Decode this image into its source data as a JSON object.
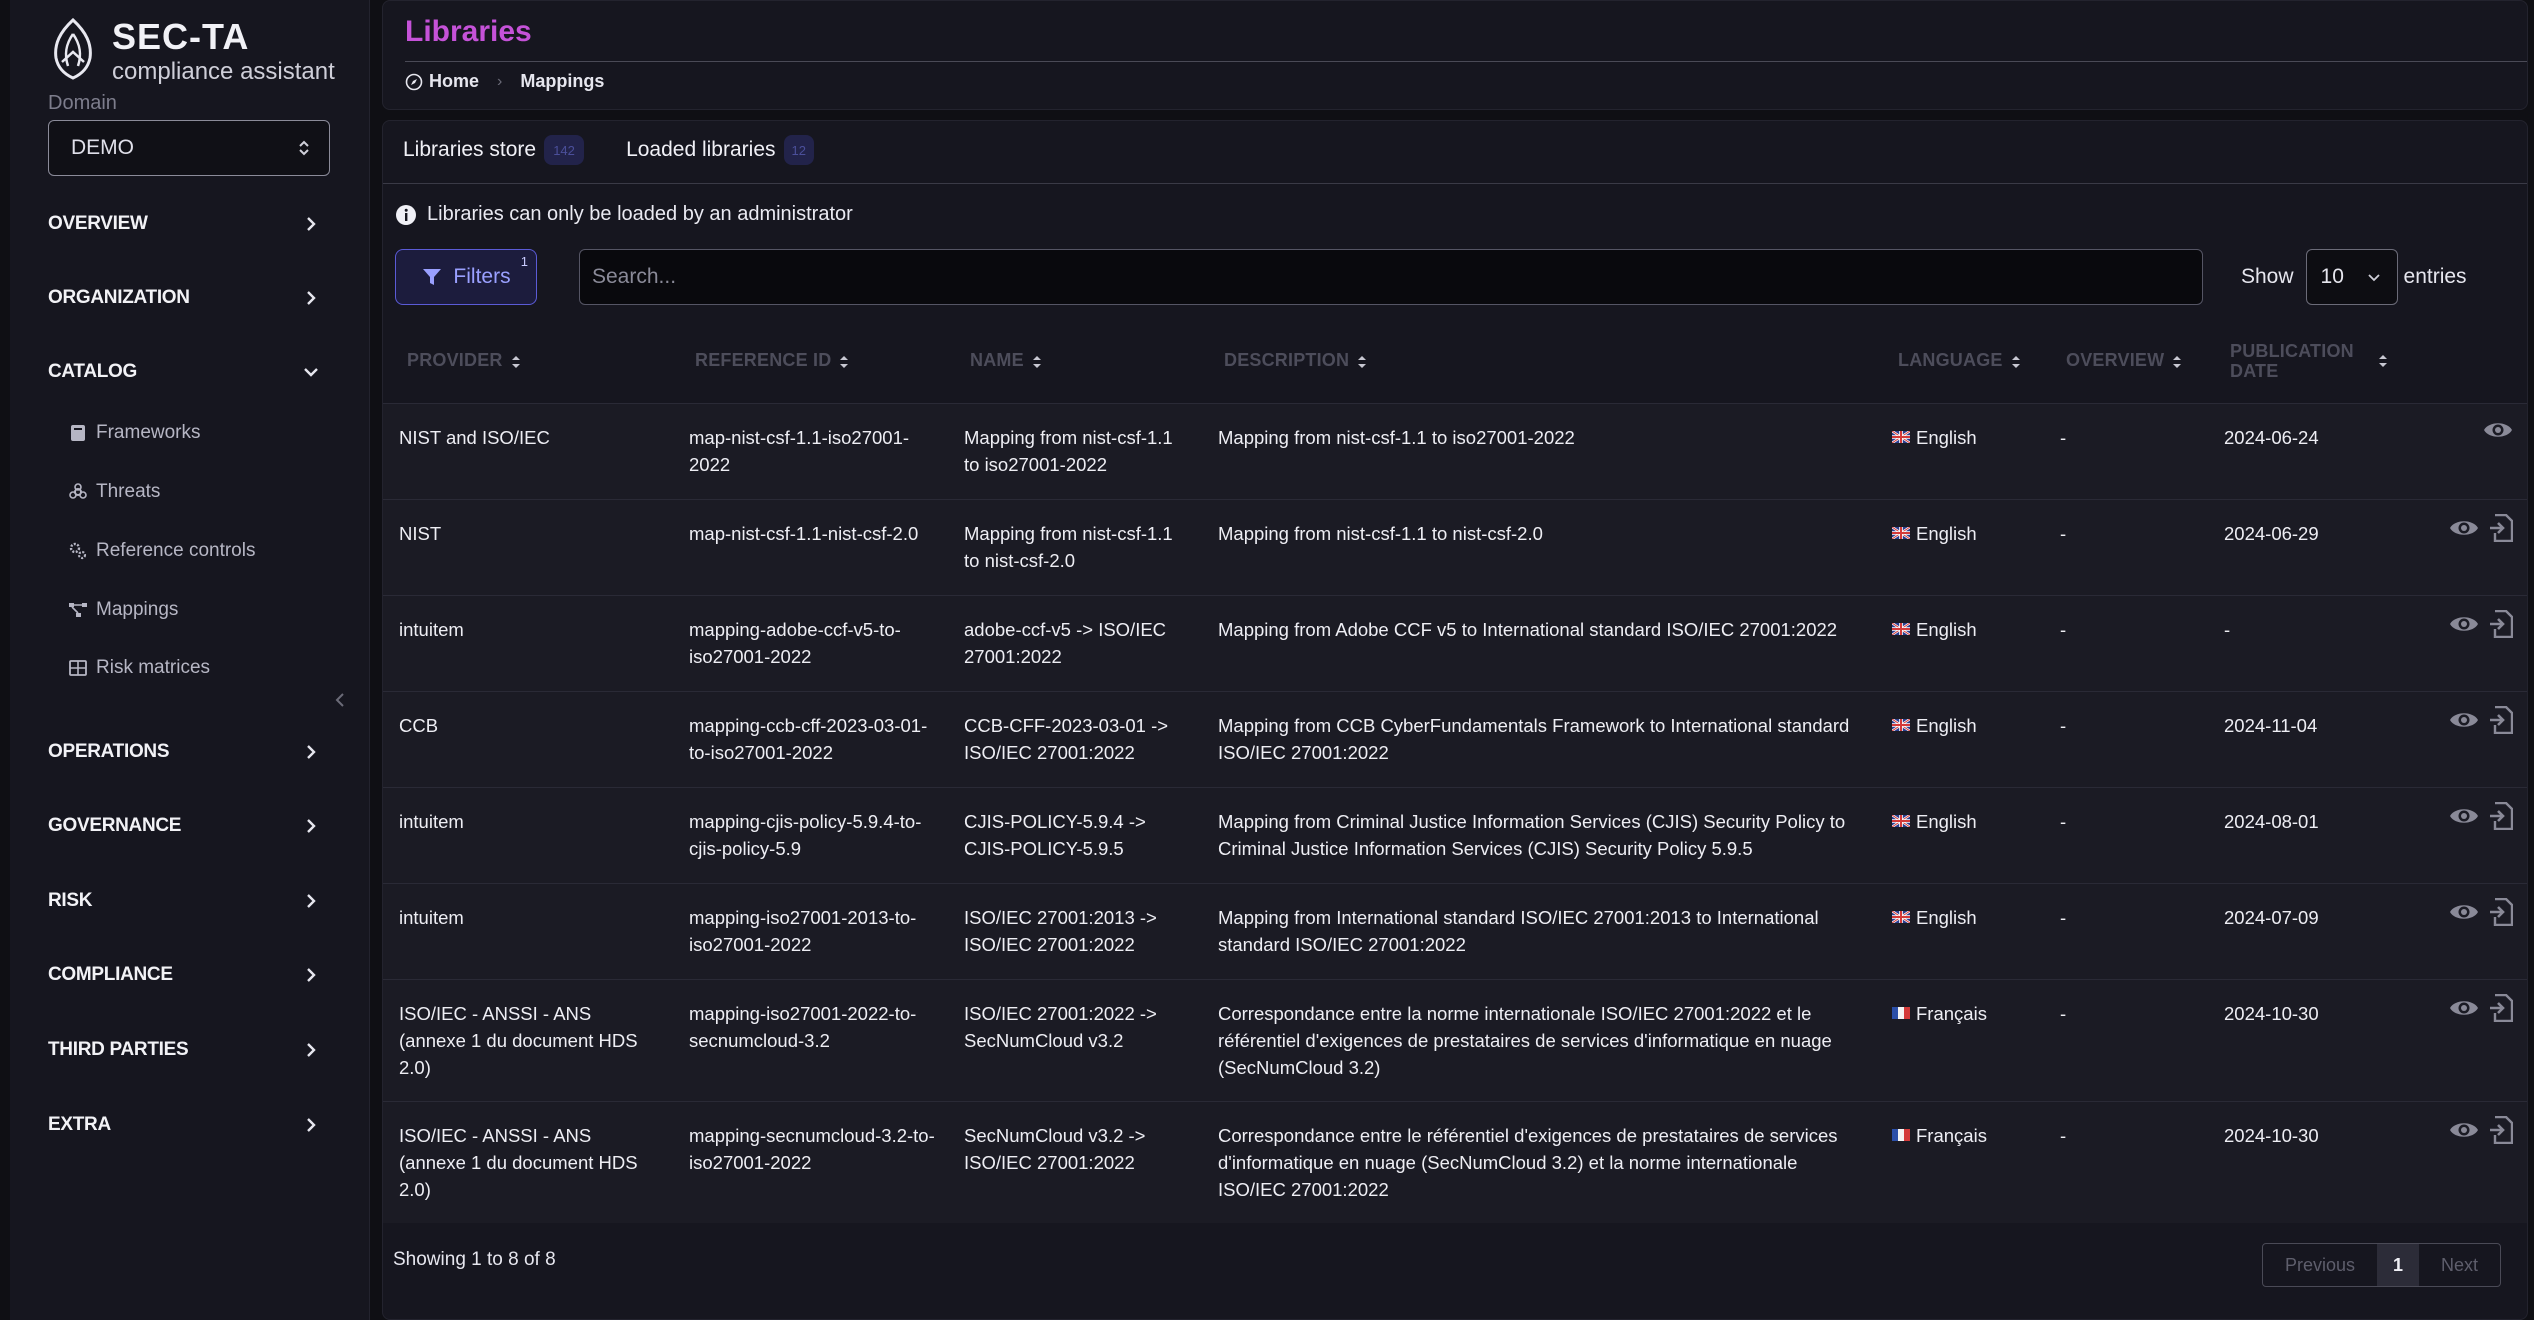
{
  "app": {
    "title": "SEC-TA",
    "subtitle": "compliance assistant"
  },
  "domain": {
    "label": "Domain",
    "value": "DEMO"
  },
  "nav": {
    "overview": "OVERVIEW",
    "organization": "ORGANIZATION",
    "catalog": "CATALOG",
    "catalog_items": [
      "Frameworks",
      "Threats",
      "Reference controls",
      "Mappings",
      "Risk matrices"
    ],
    "operations": "OPERATIONS",
    "governance": "GOVERNANCE",
    "risk": "RISK",
    "compliance": "COMPLIANCE",
    "third_parties": "THIRD PARTIES",
    "extra": "EXTRA"
  },
  "header": {
    "title": "Libraries",
    "breadcrumb": [
      "Home",
      "Mappings"
    ]
  },
  "tabs": [
    {
      "label": "Libraries store",
      "count": "142"
    },
    {
      "label": "Loaded libraries",
      "count": "12"
    }
  ],
  "notice": "Libraries can only be loaded by an administrator",
  "filters": {
    "label": "Filters",
    "count": "1"
  },
  "search": {
    "placeholder": "Search..."
  },
  "pagination_size": {
    "show": "Show",
    "value": "10",
    "entries": "entries"
  },
  "columns": [
    "PROVIDER",
    "REFERENCE ID",
    "NAME",
    "DESCRIPTION",
    "LANGUAGE",
    "OVERVIEW",
    "PUBLICATION DATE"
  ],
  "rows": [
    {
      "provider": "NIST and ISO/IEC",
      "ref": "map-nist-csf-1.1-iso27001-2022",
      "name": "Mapping from nist-csf-1.1 to iso27001-2022",
      "desc": "Mapping from nist-csf-1.1 to iso27001-2022",
      "lang": "English",
      "flag": "uk",
      "overview": "-",
      "date": "2024-06-24",
      "loadable": false
    },
    {
      "provider": "NIST",
      "ref": "map-nist-csf-1.1-nist-csf-2.0",
      "name": "Mapping from nist-csf-1.1 to nist-csf-2.0",
      "desc": "Mapping from nist-csf-1.1 to nist-csf-2.0",
      "lang": "English",
      "flag": "uk",
      "overview": "-",
      "date": "2024-06-29",
      "loadable": true
    },
    {
      "provider": "intuitem",
      "ref": "mapping-adobe-ccf-v5-to-iso27001-2022",
      "name": "adobe-ccf-v5 -> ISO/IEC 27001:2022",
      "desc": "Mapping from Adobe CCF v5 to International standard ISO/IEC 27001:2022",
      "lang": "English",
      "flag": "uk",
      "overview": "-",
      "date": "-",
      "loadable": true
    },
    {
      "provider": "CCB",
      "ref": "mapping-ccb-cff-2023-03-01-to-iso27001-2022",
      "name": "CCB-CFF-2023-03-01 -> ISO/IEC 27001:2022",
      "desc": "Mapping from CCB CyberFundamentals Framework to International standard ISO/IEC 27001:2022",
      "lang": "English",
      "flag": "uk",
      "overview": "-",
      "date": "2024-11-04",
      "loadable": true
    },
    {
      "provider": "intuitem",
      "ref": "mapping-cjis-policy-5.9.4-to-cjis-policy-5.9",
      "name": "CJIS-POLICY-5.9.4 -> CJIS-POLICY-5.9.5",
      "desc": "Mapping from Criminal Justice Information Services (CJIS) Security Policy to Criminal Justice Information Services (CJIS) Security Policy 5.9.5",
      "lang": "English",
      "flag": "uk",
      "overview": "-",
      "date": "2024-08-01",
      "loadable": true
    },
    {
      "provider": "intuitem",
      "ref": "mapping-iso27001-2013-to-iso27001-2022",
      "name": "ISO/IEC 27001:2013 -> ISO/IEC 27001:2022",
      "desc": "Mapping from International standard ISO/IEC 27001:2013 to International standard ISO/IEC 27001:2022",
      "lang": "English",
      "flag": "uk",
      "overview": "-",
      "date": "2024-07-09",
      "loadable": true
    },
    {
      "provider": "ISO/IEC - ANSSI - ANS (annexe 1 du document HDS 2.0)",
      "ref": "mapping-iso27001-2022-to-secnumcloud-3.2",
      "name": "ISO/IEC 27001:2022 -> SecNumCloud v3.2",
      "desc": "Correspondance entre la norme internationale ISO/IEC 27001:2022 et le référentiel d'exigences de prestataires de services d'informatique en nuage (SecNumCloud 3.2)",
      "lang": "Français",
      "flag": "fr",
      "overview": "-",
      "date": "2024-10-30",
      "loadable": true
    },
    {
      "provider": "ISO/IEC - ANSSI - ANS (annexe 1 du document HDS 2.0)",
      "ref": "mapping-secnumcloud-3.2-to-iso27001-2022",
      "name": "SecNumCloud v3.2 -> ISO/IEC 27001:2022",
      "desc": "Correspondance entre le référentiel d'exigences de prestataires de services d'informatique en nuage (SecNumCloud 3.2) et la norme internationale ISO/IEC 27001:2022",
      "lang": "Français",
      "flag": "fr",
      "overview": "-",
      "date": "2024-10-30",
      "loadable": true
    }
  ],
  "footer": {
    "showing": "Showing 1 to 8 of 8",
    "previous": "Previous",
    "page": "1",
    "next": "Next"
  },
  "colors": {
    "accent": "#c552d8",
    "filter": "#5b5bd6",
    "panel": "#16161f"
  }
}
